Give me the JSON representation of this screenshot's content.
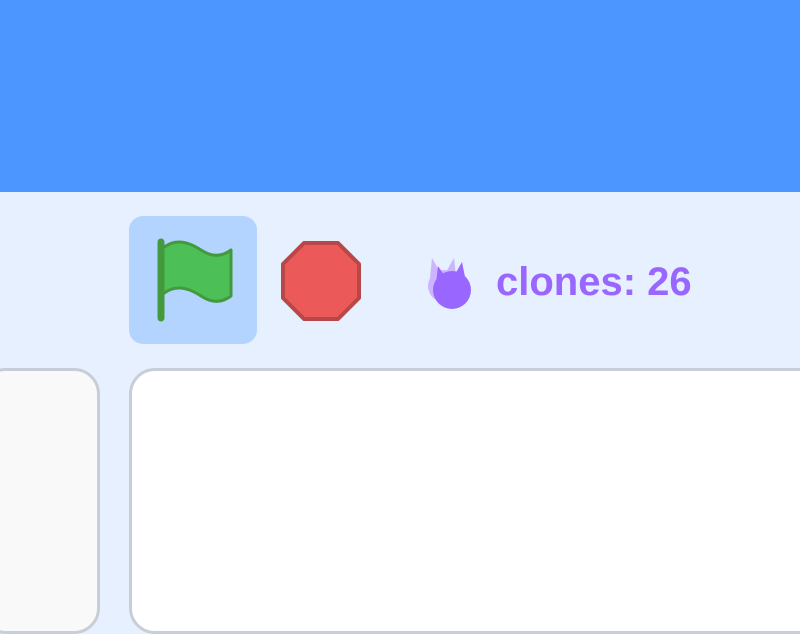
{
  "menu_bar": {
    "color": "#4c97ff"
  },
  "controls": {
    "green_flag": {
      "icon": "green-flag-icon",
      "active": true,
      "color": "#4cbf56"
    },
    "stop": {
      "icon": "stop-sign-icon",
      "color": "#ec5959"
    }
  },
  "clone_counter": {
    "icon": "clone-sprite-icon",
    "text": "clones: 26",
    "color": "#9966ff"
  }
}
